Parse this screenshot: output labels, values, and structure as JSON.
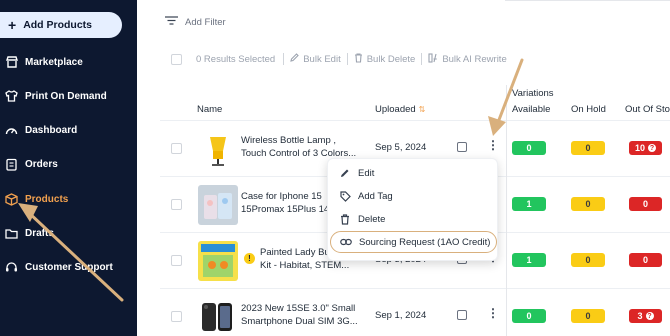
{
  "sidebar": {
    "add_label": "Add Products",
    "items": [
      {
        "label": "Marketplace",
        "icon": "store-icon"
      },
      {
        "label": "Print On Demand",
        "icon": "shirt-icon"
      },
      {
        "label": "Dashboard",
        "icon": "gauge-icon"
      },
      {
        "label": "Orders",
        "icon": "clipboard-icon"
      },
      {
        "label": "Products",
        "icon": "box-icon",
        "active": true
      },
      {
        "label": "Drafts",
        "icon": "folder-icon"
      },
      {
        "label": "Customer Support",
        "icon": "headset-icon"
      }
    ]
  },
  "filter": {
    "label": "Add Filter"
  },
  "bulk": {
    "selected": "0 Results Selected",
    "edit": "Bulk Edit",
    "delete": "Bulk Delete",
    "rewrite": "Bulk AI Rewrite"
  },
  "table": {
    "headers": {
      "name": "Name",
      "uploaded": "Uploaded",
      "variations": "Variations",
      "available": "Available",
      "on_hold": "On Hold",
      "out_of_stock": "Out Of Sto"
    },
    "rows": [
      {
        "name1": "Wireless Bottle Lamp ,",
        "name2": "Touch Control of 3 Colors...",
        "date": "Sep 5, 2024",
        "available": "0",
        "on_hold": "0",
        "out_of_stock": "10"
      },
      {
        "name1": "Case for Iphone 15",
        "name2": "15Promax 15Plus 14",
        "date": "",
        "available": "1",
        "on_hold": "0",
        "out_of_stock": "0"
      },
      {
        "name1": "Painted Lady Butterfly",
        "name2": "Kit - Habitat, STEM...",
        "date": "Sep 3, 2024",
        "available": "1",
        "on_hold": "0",
        "out_of_stock": "0"
      },
      {
        "name1": "2023 New 15SE 3.0\" Small",
        "name2": "Smartphone Dual SIM 3G...",
        "date": "Sep 1, 2024",
        "available": "0",
        "on_hold": "0",
        "out_of_stock": "3"
      }
    ]
  },
  "menu": {
    "items": [
      {
        "label": "Edit",
        "icon": "pencil-icon"
      },
      {
        "label": "Add Tag",
        "icon": "tag-icon"
      },
      {
        "label": "Delete",
        "icon": "trash-icon"
      },
      {
        "label": "Sourcing Request (1AO Credit)",
        "icon": "link-icon"
      }
    ]
  },
  "colors": {
    "sidebar_bg": "#0d1830",
    "accent": "#f2a14f",
    "green": "#22c55e",
    "yellow": "#facc15",
    "red": "#dc2626",
    "arrow": "#d9b07d"
  }
}
